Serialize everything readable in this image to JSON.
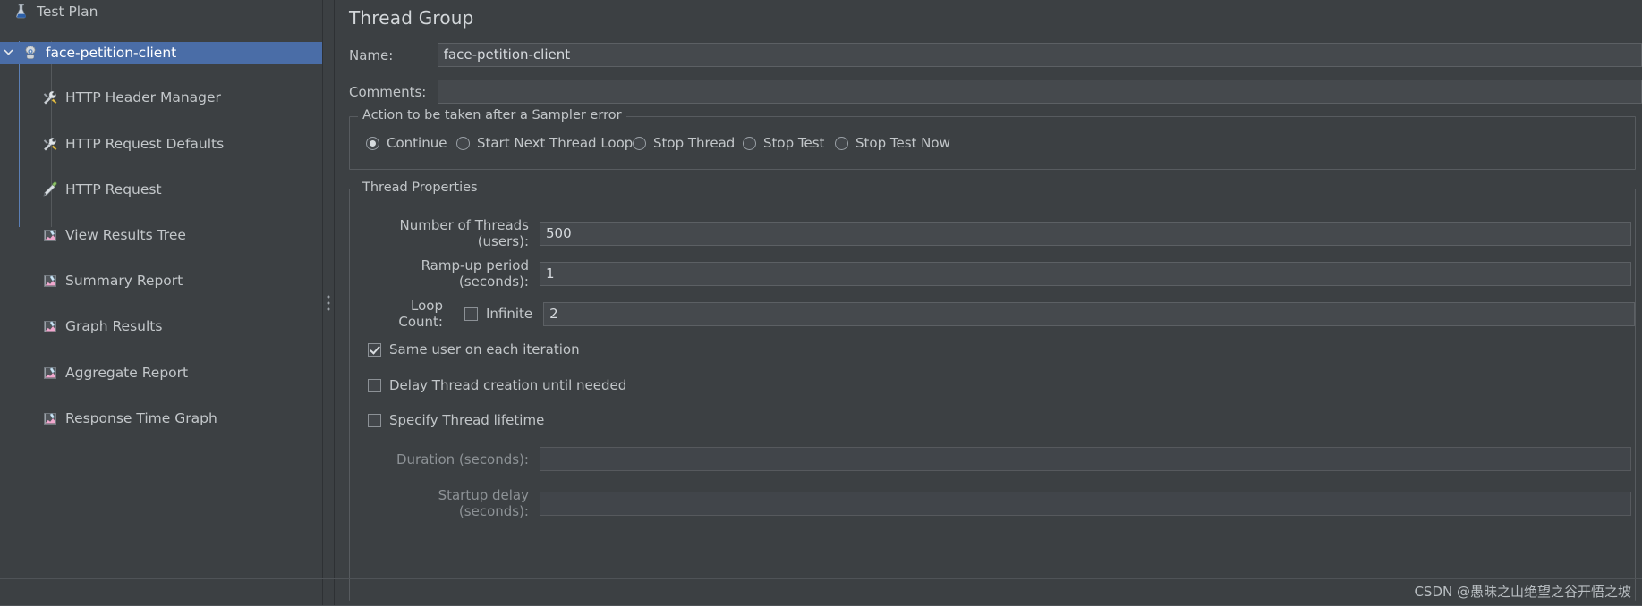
{
  "app": {
    "accent_selected": "#4a6da7",
    "background": "#3c4043",
    "text_color": "#c2c6c9"
  },
  "sidebar": {
    "items": [
      {
        "label": "Test Plan",
        "icon": "test-plan-icon",
        "depth": 0,
        "selected": false,
        "twisty": ""
      },
      {
        "label": "face-petition-client",
        "icon": "thread-group-icon",
        "depth": 1,
        "selected": true,
        "twisty": "v"
      },
      {
        "label": "HTTP Header Manager",
        "icon": "config-element-icon",
        "depth": 2,
        "selected": false,
        "twisty": ""
      },
      {
        "label": "HTTP Request Defaults",
        "icon": "config-element-icon",
        "depth": 2,
        "selected": false,
        "twisty": ""
      },
      {
        "label": "HTTP Request",
        "icon": "sampler-icon",
        "depth": 2,
        "selected": false,
        "twisty": ""
      },
      {
        "label": "View Results Tree",
        "icon": "listener-icon",
        "depth": 2,
        "selected": false,
        "twisty": ""
      },
      {
        "label": "Summary Report",
        "icon": "listener-icon",
        "depth": 2,
        "selected": false,
        "twisty": ""
      },
      {
        "label": "Graph Results",
        "icon": "listener-icon",
        "depth": 2,
        "selected": false,
        "twisty": ""
      },
      {
        "label": "Aggregate Report",
        "icon": "listener-icon",
        "depth": 2,
        "selected": false,
        "twisty": ""
      },
      {
        "label": "Response Time Graph",
        "icon": "listener-icon",
        "depth": 2,
        "selected": false,
        "twisty": ""
      }
    ]
  },
  "main": {
    "title": "Thread Group",
    "name": {
      "label": "Name:",
      "value": "face-petition-client",
      "placeholder": ""
    },
    "comments": {
      "label": "Comments:",
      "value": "",
      "placeholder": ""
    },
    "sampler_error": {
      "legend": "Action to be taken after a Sampler error",
      "options": [
        {
          "label": "Continue",
          "checked": true
        },
        {
          "label": "Start Next Thread Loop",
          "checked": false
        },
        {
          "label": "Stop Thread",
          "checked": false
        },
        {
          "label": "Stop Test",
          "checked": false
        },
        {
          "label": "Stop Test Now",
          "checked": false
        }
      ]
    },
    "thread_properties": {
      "legend": "Thread Properties",
      "number_of_threads": {
        "label": "Number of Threads (users):",
        "value": "500"
      },
      "ramp_up": {
        "label": "Ramp-up period (seconds):",
        "value": "1"
      },
      "loop_count": {
        "label": "Loop Count:",
        "infinite_label": "Infinite",
        "infinite_checked": false,
        "value": "2"
      },
      "checkboxes": [
        {
          "label": "Same user on each iteration",
          "checked": true
        },
        {
          "label": "Delay Thread creation until needed",
          "checked": false
        },
        {
          "label": "Specify Thread lifetime",
          "checked": false
        }
      ],
      "duration": {
        "label": "Duration (seconds):",
        "value": "",
        "disabled": true
      },
      "startup_delay": {
        "label": "Startup delay (seconds):",
        "value": "",
        "disabled": true
      }
    }
  },
  "watermark": {
    "text": "CSDN @愚昧之山绝望之谷开悟之坡"
  }
}
